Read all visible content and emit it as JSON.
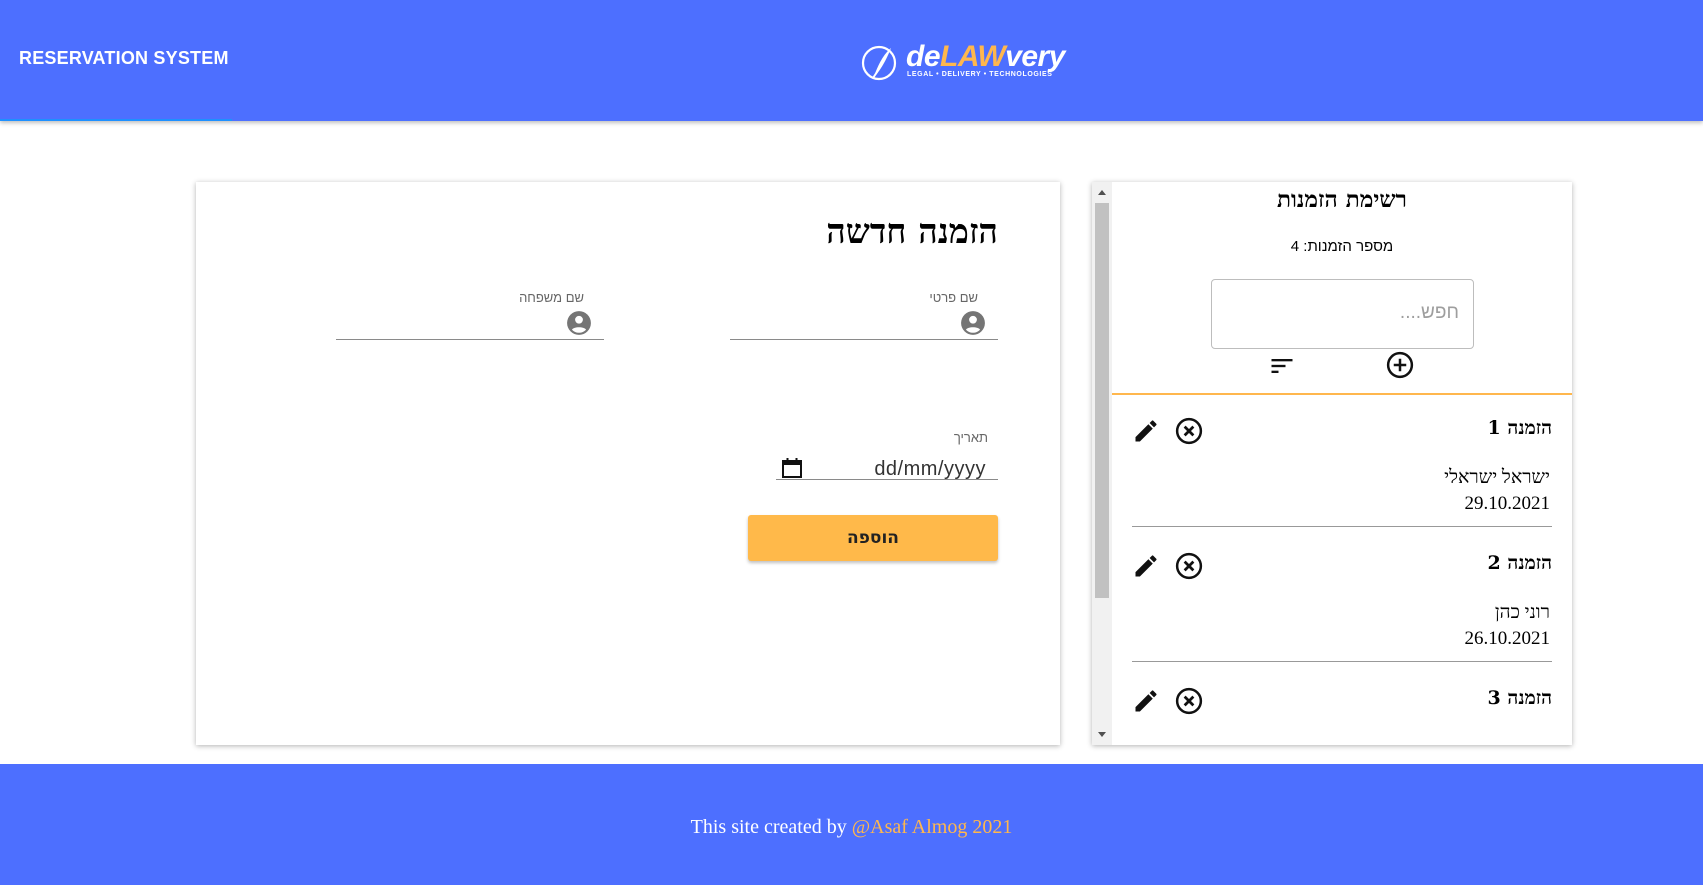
{
  "header": {
    "title": "RESERVATION SYSTEM",
    "logo_text_de": "de",
    "logo_text_law": "LAW",
    "logo_text_very": "very",
    "logo_tagline": "LEGAL • DELIVERY • TECHNOLOGIES"
  },
  "form": {
    "title": "הזמנה חדשה",
    "first_name_label": "שם פרטי",
    "last_name_label": "שם משפחה",
    "date_label": "תאריך",
    "date_placeholder": "dd/mm/yyyy",
    "add_button_label": "הוספה"
  },
  "list": {
    "title": "רשימת הזמנות",
    "count_text": "מספר הזמנות: 4",
    "search_placeholder": "חפש....",
    "bookings": [
      {
        "title": "הזמנה 1",
        "name": "ישראל ישראלי",
        "date": "29.10.2021"
      },
      {
        "title": "הזמנה 2",
        "name": "רוני כהן",
        "date": "26.10.2021"
      },
      {
        "title": "הזמנה 3"
      }
    ]
  },
  "footer": {
    "credit_prefix": "This site created by ",
    "credit_author": "@Asaf Almog 2021"
  },
  "colors": {
    "brand_blue": "#4d6fff",
    "accent_orange": "#ffb94a"
  }
}
